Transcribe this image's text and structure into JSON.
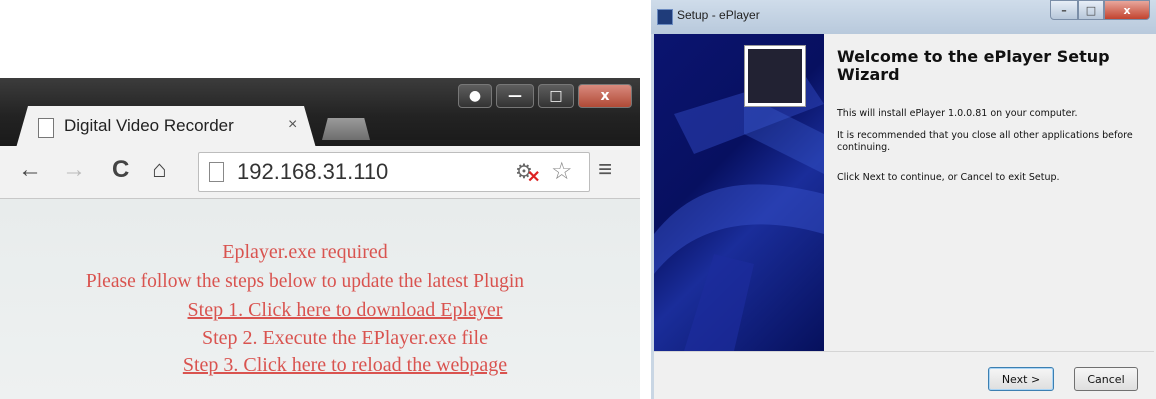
{
  "browser": {
    "tab_title": "Digital Video Recorder",
    "tab_close": "×",
    "url": "192.168.31.110",
    "nav": {
      "back": "←",
      "forward": "→",
      "reload": "C",
      "home": "⌂"
    },
    "window_buttons": {
      "minimize": "—",
      "maximize": "□",
      "close": "x"
    },
    "menu_icon": "≡",
    "content": {
      "line1": "Eplayer.exe required",
      "line2": "Please follow the steps below to update the latest Plugin",
      "step1": "Step 1. Click here to download Eplayer",
      "step2": "Step 2. Execute the EPlayer.exe file",
      "step3": "Step 3. Click here to reload the webpage"
    },
    "text_color": "#d9534f"
  },
  "setup": {
    "window_title": "Setup - ePlayer",
    "heading": "Welcome to the ePlayer Setup Wizard",
    "para1": "This will install ePlayer 1.0.0.81 on your computer.",
    "para2": "It is recommended that you close all other applications before continuing.",
    "para3": "Click Next to continue, or Cancel to exit Setup.",
    "next_label": "Next >",
    "cancel_label": "Cancel",
    "window_buttons": {
      "minimize": "–",
      "maximize": "□",
      "close": "x"
    }
  }
}
